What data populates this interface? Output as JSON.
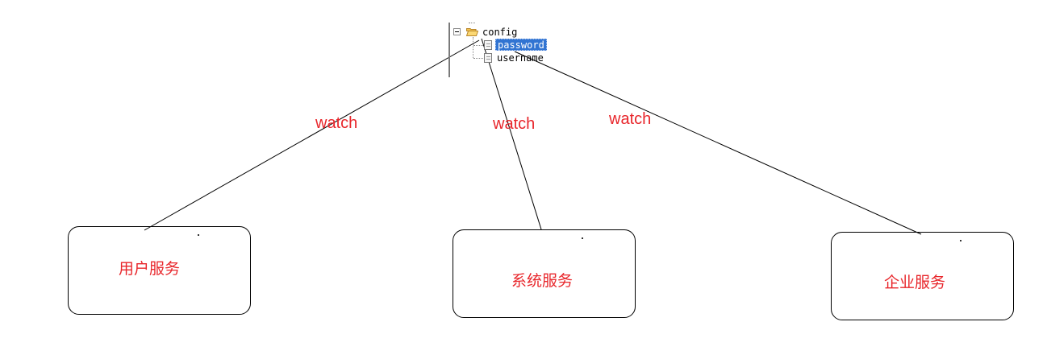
{
  "tree": {
    "root_label": "config",
    "children": [
      {
        "label": "password",
        "selected": true
      },
      {
        "label": "username",
        "selected": false
      }
    ],
    "selection_color": "#3174d2"
  },
  "edges": [
    {
      "label": "watch"
    },
    {
      "label": "watch"
    },
    {
      "label": "watch"
    }
  ],
  "services": [
    {
      "label": "用户服务"
    },
    {
      "label": "系统服务"
    },
    {
      "label": "企业服务"
    }
  ],
  "colors": {
    "label_red": "#e8262b",
    "line": "#000000"
  },
  "icons": {
    "expander": "collapse-minus-icon",
    "folder": "open-folder-icon",
    "file": "document-icon"
  }
}
